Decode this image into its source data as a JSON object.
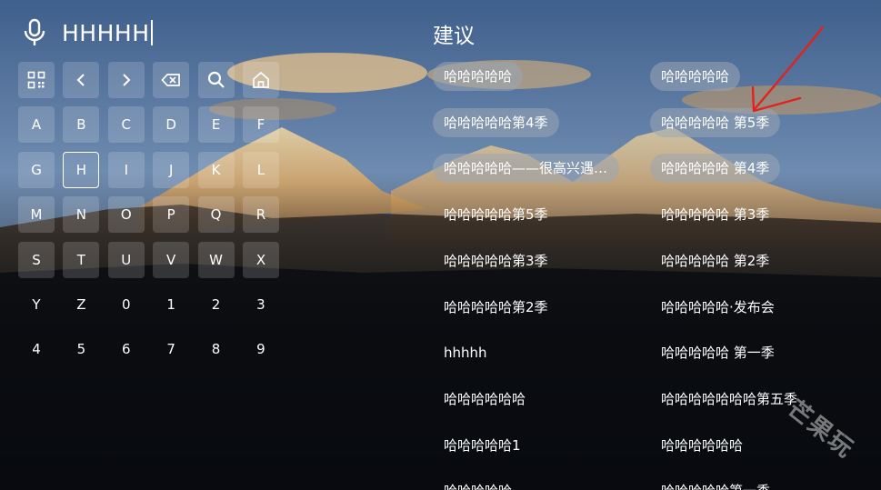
{
  "search": {
    "query": "HHHHH",
    "mic_icon": "microphone-icon"
  },
  "keyboard": {
    "function_keys": [
      {
        "name": "qr-code-icon",
        "label": ""
      },
      {
        "name": "arrow-left-icon",
        "label": ""
      },
      {
        "name": "arrow-right-icon",
        "label": ""
      },
      {
        "name": "backspace-icon",
        "label": ""
      },
      {
        "name": "search-icon",
        "label": ""
      },
      {
        "name": "home-icon",
        "label": ""
      }
    ],
    "rows": [
      [
        "A",
        "B",
        "C",
        "D",
        "E",
        "F"
      ],
      [
        "G",
        "H",
        "I",
        "J",
        "K",
        "L"
      ],
      [
        "M",
        "N",
        "O",
        "P",
        "Q",
        "R"
      ],
      [
        "S",
        "T",
        "U",
        "V",
        "W",
        "X"
      ],
      [
        "Y",
        "Z",
        "0",
        "1",
        "2",
        "3"
      ],
      [
        "4",
        "5",
        "6",
        "7",
        "8",
        "9"
      ]
    ],
    "focused_key": "H"
  },
  "suggestions": {
    "title": "建议",
    "left": [
      "哈哈哈哈哈",
      "哈哈哈哈哈第4季",
      "哈哈哈哈哈——很高兴遇见你",
      "哈哈哈哈哈第5季",
      "哈哈哈哈哈第3季",
      "哈哈哈哈哈第2季",
      "hhhhh",
      "哈哈哈哈哈哈",
      "哈哈哈哈哈1",
      "哈哈哈哈哈"
    ],
    "right": [
      "哈哈哈哈哈",
      "哈哈哈哈哈 第5季",
      "哈哈哈哈哈 第4季",
      "哈哈哈哈哈 第3季",
      "哈哈哈哈哈 第2季",
      "哈哈哈哈哈·发布会",
      "哈哈哈哈哈 第一季",
      "哈哈哈哈哈哈哈第五季",
      "哈哈哈哈哈哈",
      "哈哈哈哈哈第一季"
    ],
    "highlighted_left": [
      0,
      1,
      2
    ],
    "highlighted_right": [
      0,
      1,
      2
    ]
  },
  "watermark": "芒果玩",
  "colors": {
    "annotation": "#e0231c",
    "pill_highlight": "#9ba5b4"
  }
}
